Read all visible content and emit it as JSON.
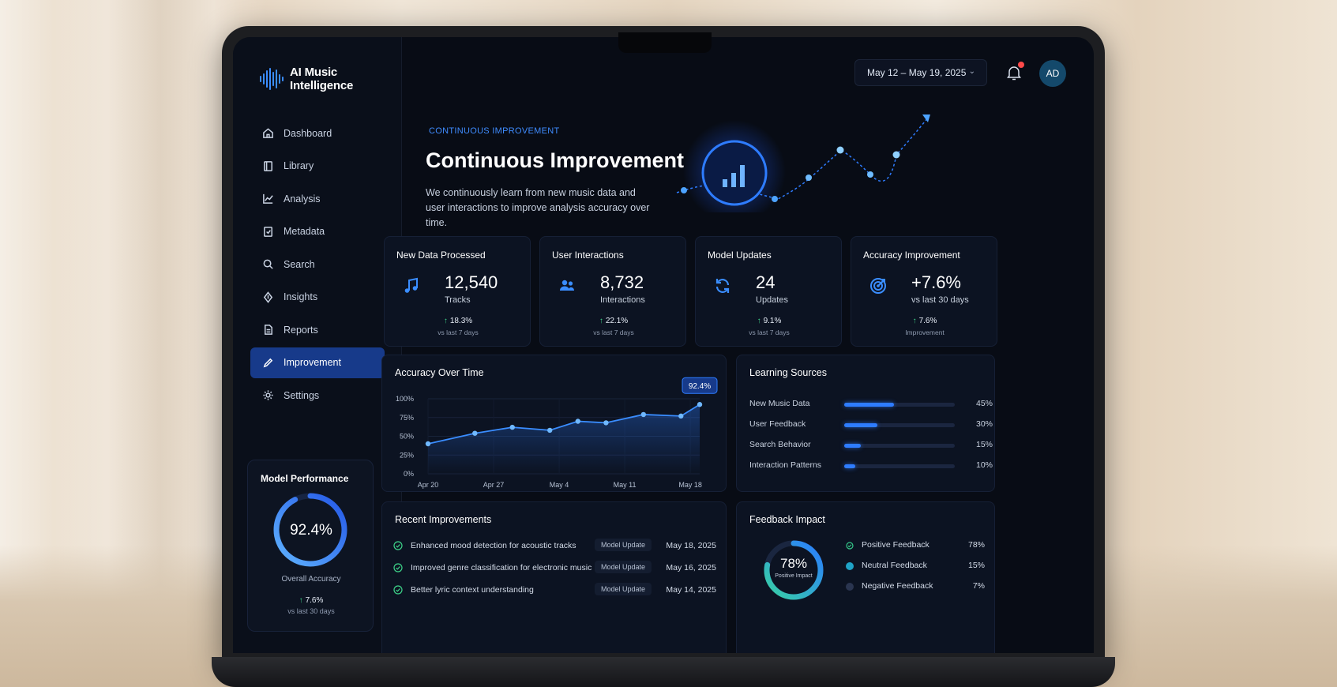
{
  "app": {
    "title": "AI Music Intelligence"
  },
  "sidebar": {
    "items": [
      {
        "label": "Dashboard",
        "icon": "home-icon"
      },
      {
        "label": "Library",
        "icon": "book-icon"
      },
      {
        "label": "Analysis",
        "icon": "chart-icon"
      },
      {
        "label": "Metadata",
        "icon": "tag-icon"
      },
      {
        "label": "Search",
        "icon": "search-icon"
      },
      {
        "label": "Insights",
        "icon": "bulb-icon"
      },
      {
        "label": "Reports",
        "icon": "file-icon"
      },
      {
        "label": "Improvement",
        "icon": "pencil-icon",
        "active": true
      },
      {
        "label": "Settings",
        "icon": "gear-icon"
      }
    ],
    "model_performance": {
      "title": "Model Performance",
      "value": "92.4%",
      "fraction": 0.924,
      "label": "Overall Accuracy",
      "delta": "7.6%",
      "delta_sub": "vs last 30 days"
    }
  },
  "header": {
    "date_range": "May 12 – May 19, 2025",
    "avatar_initials": "AD"
  },
  "hero": {
    "eyebrow": "CONTINUOUS IMPROVEMENT",
    "title": "Continuous Improvement",
    "description": "We continuously learn from new music data and user interactions to improve analysis accuracy over time."
  },
  "stats": [
    {
      "title": "New Data Processed",
      "value": "12,540",
      "unit": "Tracks",
      "delta": "18.3%",
      "sub": "vs last 7 days",
      "icon": "music-note-icon"
    },
    {
      "title": "User Interactions",
      "value": "8,732",
      "unit": "Interactions",
      "delta": "22.1%",
      "sub": "vs last 7 days",
      "icon": "users-icon"
    },
    {
      "title": "Model Updates",
      "value": "24",
      "unit": "Updates",
      "delta": "9.1%",
      "sub": "vs last 7 days",
      "icon": "refresh-icon"
    },
    {
      "title": "Accuracy Improvement",
      "value": "+7.6%",
      "unit": "vs last 30 days",
      "delta": "7.6%",
      "sub": "Improvement",
      "icon": "target-icon"
    }
  ],
  "accuracy_chart": {
    "title": "Accuracy Over Time",
    "callout": "92.4%"
  },
  "chart_data": {
    "type": "line",
    "title": "Accuracy Over Time",
    "xlabel": "",
    "ylabel": "",
    "x_tick_labels": [
      "Apr 20",
      "Apr 27",
      "May 4",
      "May 11",
      "May 18"
    ],
    "y_tick_labels": [
      "100%",
      "75%",
      "50%",
      "25%",
      "0%"
    ],
    "ylim": [
      0,
      100
    ],
    "grid": true,
    "series": [
      {
        "points": [
          {
            "x": "Apr 20",
            "y": 40
          },
          {
            "x": "Apr 25",
            "y": 54
          },
          {
            "x": "Apr 29",
            "y": 62
          },
          {
            "x": "May 3",
            "y": 58
          },
          {
            "x": "May 6",
            "y": 70
          },
          {
            "x": "May 9",
            "y": 68
          },
          {
            "x": "May 13",
            "y": 79
          },
          {
            "x": "May 17",
            "y": 77
          },
          {
            "x": "May 19",
            "y": 92.4
          }
        ]
      }
    ]
  },
  "learning_sources": {
    "title": "Learning Sources",
    "items": [
      {
        "label": "New Music Data",
        "pct": "45%",
        "value": 0.45
      },
      {
        "label": "User Feedback",
        "pct": "30%",
        "value": 0.3
      },
      {
        "label": "Search Behavior",
        "pct": "15%",
        "value": 0.15
      },
      {
        "label": "Interaction Patterns",
        "pct": "10%",
        "value": 0.1
      }
    ]
  },
  "recent_improvements": {
    "title": "Recent Improvements",
    "items": [
      {
        "text": "Enhanced mood detection for acoustic tracks",
        "badge": "Model Update",
        "date": "May 18, 2025"
      },
      {
        "text": "Improved genre classification for electronic music",
        "badge": "Model Update",
        "date": "May 16, 2025"
      },
      {
        "text": "Better lyric context understanding",
        "badge": "Model Update",
        "date": "May 14, 2025"
      }
    ]
  },
  "feedback_impact": {
    "title": "Feedback Impact",
    "value": "78%",
    "sub": "Positive Impact",
    "fraction": 0.78,
    "items": [
      {
        "label": "Positive Feedback",
        "pct": "78%",
        "color": "#35c98a"
      },
      {
        "label": "Neutral Feedback",
        "pct": "15%",
        "color": "#1fa3c7"
      },
      {
        "label": "Negative Feedback",
        "pct": "7%",
        "color": "#2a3550"
      }
    ]
  },
  "colors": {
    "accent": "#2e7cff",
    "positive": "#3ed58a",
    "background": "#080c15"
  }
}
